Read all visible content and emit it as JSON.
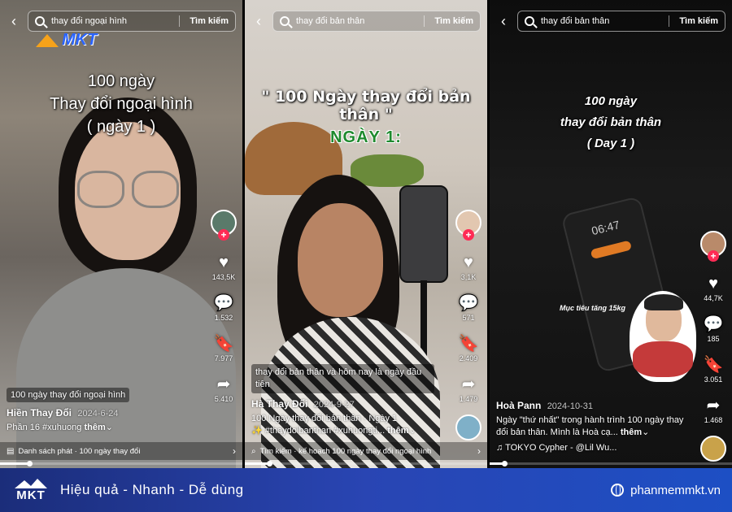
{
  "panels": [
    {
      "search_query": "thay đổi ngoại hình",
      "search_button": "Tìm kiếm",
      "overlay": {
        "line1": "100 ngày",
        "line2": "Thay đổi ngoại hình",
        "line3": "( ngày 1 )"
      },
      "watermark_text": "MKT",
      "likes": "143,5K",
      "comments": "1.532",
      "saves": "7.977",
      "shares": "5.410",
      "tag_pill": "100 ngày thay đổi ngoại hình",
      "author": "Hiền Thay Đổi",
      "date": "2024-6-24",
      "description": "Phần 16 #xuhuong",
      "more": "thêm",
      "bottom_bar": "Danh sách phát · 100 ngày thay đổi",
      "progress": 0.12
    },
    {
      "search_query": "thay đổi bản thân",
      "search_button": "Tìm kiếm",
      "overlay": {
        "line1": "\" 100 Ngày thay đổi bản thân \"",
        "line2": "NGÀY 1:"
      },
      "likes": "3,1K",
      "comments": "571",
      "saves": "2.409",
      "shares": "1.479",
      "tag_pill": "thay đổi bản thân và hôm nay là ngày đầu tiên",
      "author": "Hà Thay Đổi",
      "date": "2024-9-27",
      "description": "100 Ngày thay đổi bản thân - Ngày 1",
      "description2": "✨ #thaydoibanthan #xuhuongti...",
      "more": "thêm",
      "bottom_bar": "Tìm kiếm · kế hoạch 100 ngày thay đổi ngoại hình",
      "progress": 0.1
    },
    {
      "search_query": "thay đổi bản thân",
      "search_button": "Tìm kiếm",
      "overlay": {
        "line1": "100 ngày",
        "line2": "thay đổi bản thân",
        "line3": "( Day 1 )"
      },
      "phone_time": "06:47",
      "goal_text": "Mục tiêu tăng 15kg",
      "likes": "44,7K",
      "comments": "185",
      "saves": "3.051",
      "shares": "1.468",
      "author": "Hoà Pann",
      "date": "2024-10-31",
      "description": "Ngày \"thứ nhất\" trong hành trình 100 ngày thay đổi bản thân. Mình là Hoà cạ...",
      "more": "thêm",
      "music": "TOKYO Cypher - @Lil Wu...",
      "progress": 0.06
    }
  ],
  "footer": {
    "logo": "MKT",
    "slogan": "Hiệu quả - Nhanh - Dễ dùng",
    "website": "phanmemmkt.vn"
  },
  "colors": {
    "accent_red": "#ff2b55",
    "footer_blue": "#2945b3"
  }
}
